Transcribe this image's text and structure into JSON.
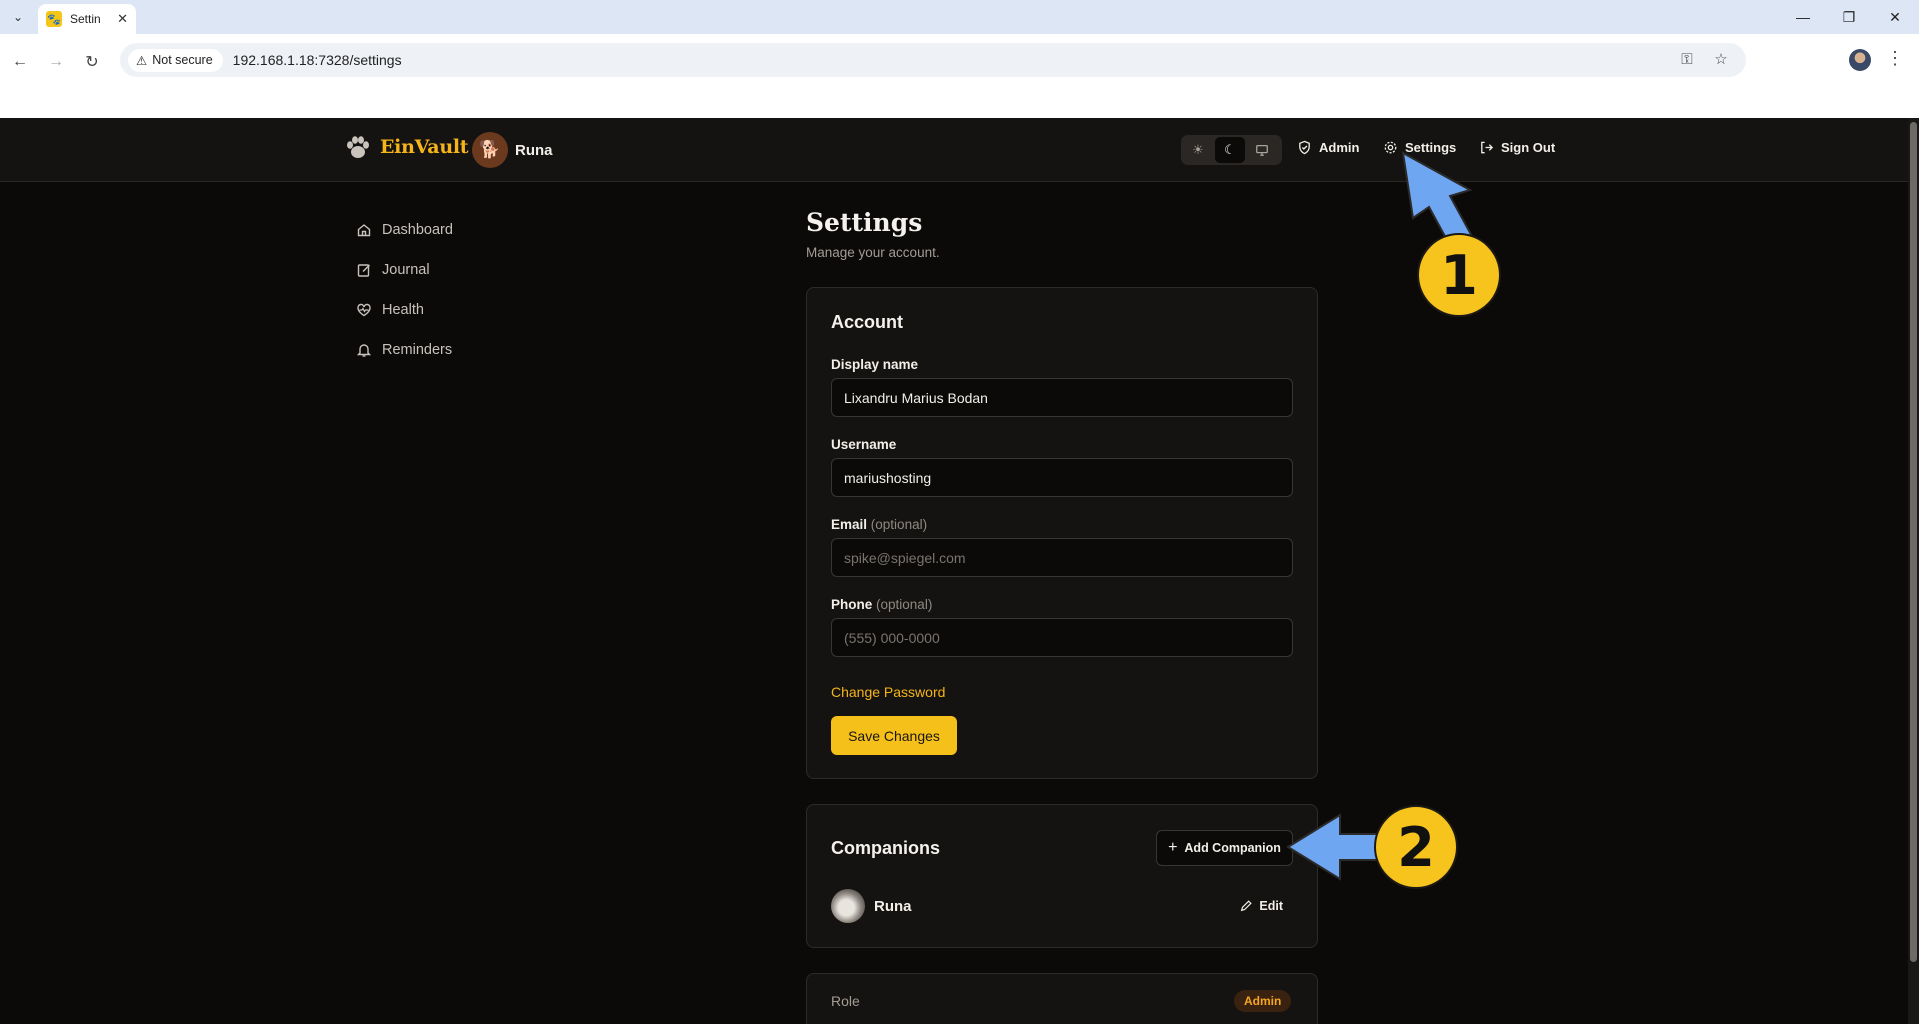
{
  "browser": {
    "tab_title": "Settin",
    "security_label": "Not secure",
    "url": "192.168.1.18:7328/settings"
  },
  "app": {
    "brand": "EinVault",
    "current_pet": "Runa",
    "nav": {
      "admin": "Admin",
      "settings": "Settings",
      "sign_out": "Sign Out"
    },
    "sidebar": [
      {
        "label": "Dashboard",
        "icon": "home-icon"
      },
      {
        "label": "Journal",
        "icon": "edit-note-icon"
      },
      {
        "label": "Health",
        "icon": "heart-pulse-icon"
      },
      {
        "label": "Reminders",
        "icon": "bell-icon"
      }
    ]
  },
  "page": {
    "title": "Settings",
    "subtitle": "Manage your account."
  },
  "account": {
    "title": "Account",
    "display_name_label": "Display name",
    "display_name_value": "Lixandru Marius Bodan",
    "username_label": "Username",
    "username_value": "mariushosting",
    "email_label": "Email",
    "email_optional": "(optional)",
    "email_placeholder": "spike@spiegel.com",
    "phone_label": "Phone",
    "phone_optional": "(optional)",
    "phone_placeholder": "(555) 000-0000",
    "change_password": "Change Password",
    "save_label": "Save Changes"
  },
  "companions": {
    "title": "Companions",
    "add_label": "Add Companion",
    "items": [
      {
        "name": "Runa",
        "edit_label": "Edit"
      }
    ]
  },
  "role": {
    "label": "Role",
    "badge": "Admin"
  },
  "annotations": {
    "callout_1": "1",
    "callout_2": "2"
  },
  "colors": {
    "accent": "#f5c01a",
    "brand": "#f5b419",
    "arrow": "#6fa6f2",
    "background": "#0b0a09",
    "card": "#151311"
  }
}
